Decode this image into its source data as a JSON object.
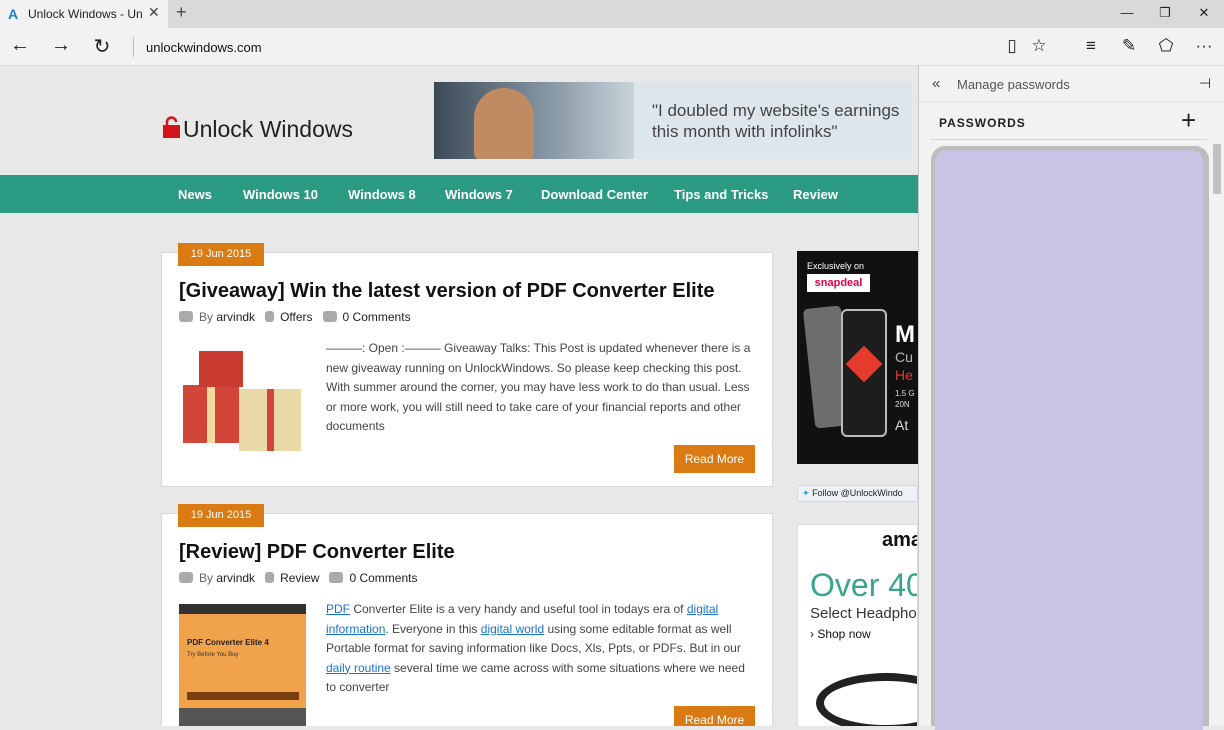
{
  "browser": {
    "tab": {
      "title": "Unlock Windows - Unlo",
      "favicon": "A",
      "close": "✕"
    },
    "new_tab": "+",
    "window_controls": {
      "minimize": "—",
      "maximize": "❐",
      "close": "✕"
    },
    "nav": {
      "back": "←",
      "forward": "→",
      "refresh": "↻"
    },
    "address": "unlockwindows.com",
    "toolbar_icons": {
      "reading_view": "▯",
      "favorite": "☆",
      "hub": "≡",
      "web_note": "✎",
      "share": "⬠",
      "more": "···"
    }
  },
  "page": {
    "logo_text": "Unlock Windows",
    "banner_text_line1": "\"I doubled my website's earnings",
    "banner_text_line2": "this month with infolinks\"",
    "menu": [
      "News",
      "Windows 10",
      "Windows 8",
      "Windows 7",
      "Download Center",
      "Tips and Tricks",
      "Review"
    ],
    "posts": [
      {
        "date": "19 Jun 2015",
        "title": "[Giveaway] Win the latest version of PDF Converter Elite",
        "by": "By",
        "author": "arvindk",
        "category": "Offers",
        "comments": "0 Comments",
        "excerpt": "———: Open :——— Giveaway Talks: This Post is updated whenever there is a new giveaway running on UnlockWindows. So please keep checking this post. With summer around the corner, you may have less work to do than usual. Less or more work, you will still need to take care of your financial reports and other documents",
        "read_more": "Read More"
      },
      {
        "date": "19 Jun 2015",
        "title": "[Review] PDF Converter Elite",
        "by": "By",
        "author": "arvindk",
        "category": "Review",
        "comments": "0 Comments",
        "excerpt_links": [
          "PDF",
          "digital information",
          "digital world",
          "daily routine"
        ],
        "excerpt_parts": [
          " Converter Elite is a very handy and useful tool in todays era of ",
          ". Everyone in this ",
          " using some editable format as well Portable format for saving information like Docs, Xls, Ppts, or PDFs. But in our ",
          " several time we came across with some situations where we need to converter"
        ],
        "read_more": "Read More",
        "thumb_title": "PDF Converter Elite 4",
        "thumb_sub": "Try Before You Buy"
      }
    ],
    "ad1": {
      "exclusive": "Exclusively on",
      "brand": "snapdeal",
      "big": "M",
      "line2": "Cu",
      "line3": "He",
      "line4": "1.5 G",
      "line5": "20N",
      "line6": "At"
    },
    "follow": "Follow @UnlockWindo",
    "ad2": {
      "brand": "ama",
      "headline": "Over 40",
      "sub": "Select Headphon",
      "cta": "› Shop now"
    }
  },
  "pane": {
    "back": "«",
    "title": "Manage passwords",
    "pin": "⊣",
    "section": "PASSWORDS",
    "add": "+"
  },
  "colors": {
    "menu_bg": "#2b9a83",
    "accent_orange": "#d97a12",
    "pw_list": "#c8c4e6"
  }
}
